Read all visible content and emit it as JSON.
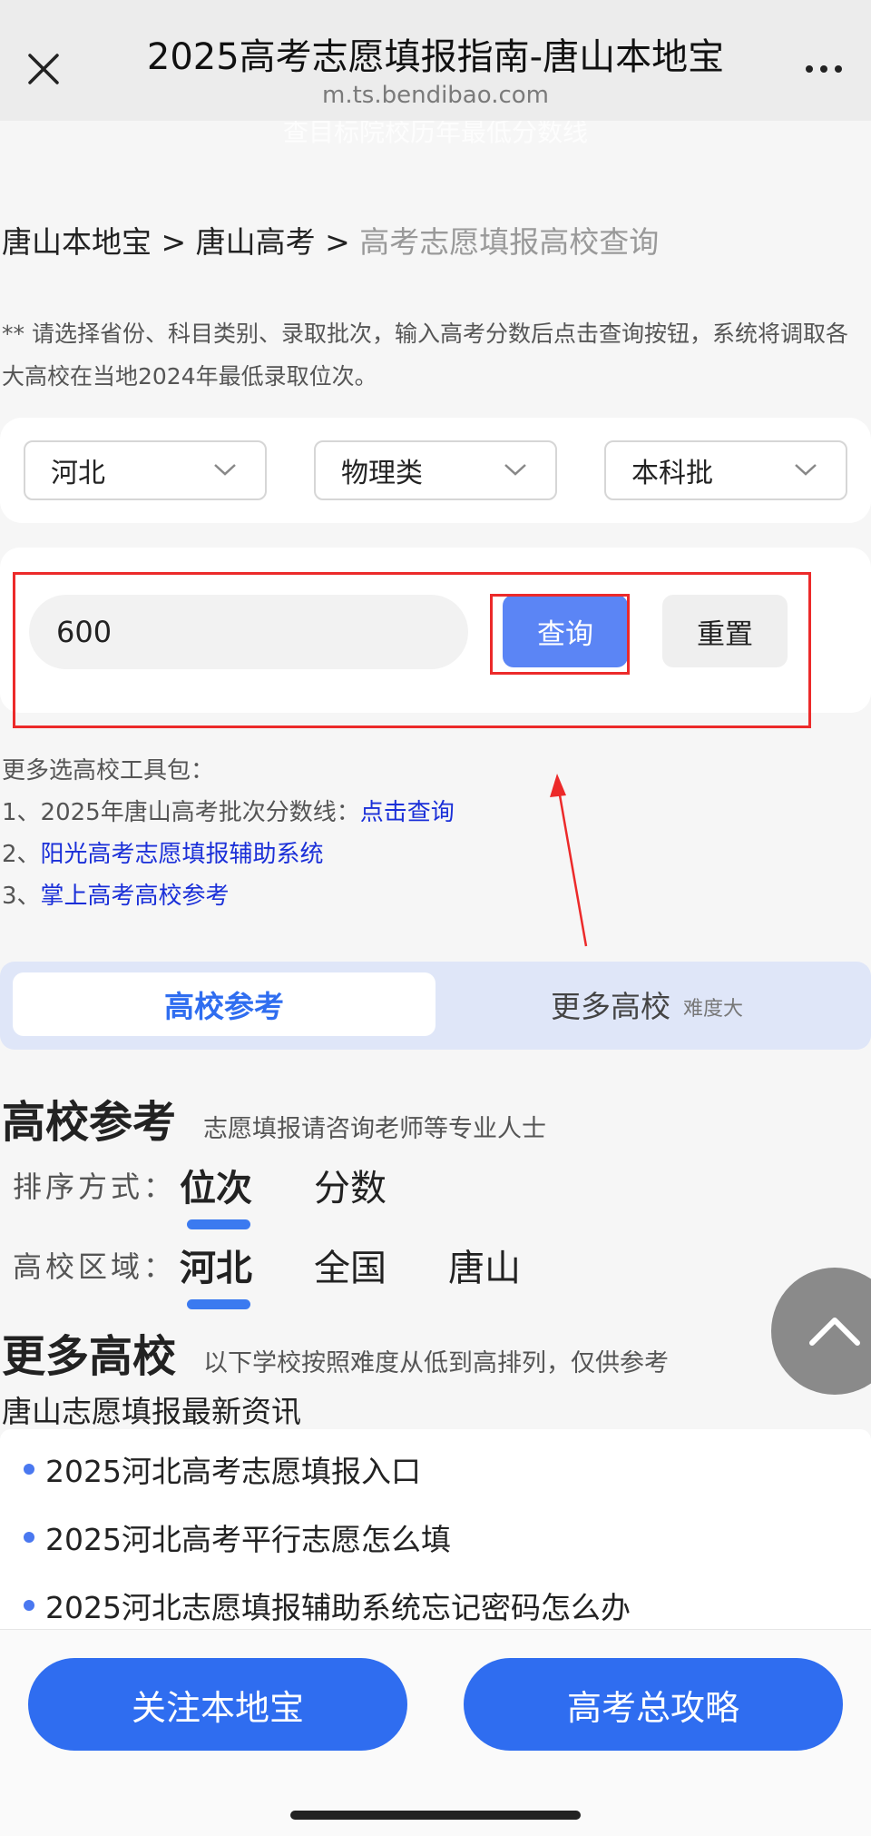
{
  "window": {
    "title": "2025高考志愿填报指南-唐山本地宝",
    "url": "m.ts.bendibao.com"
  },
  "ghost_text": "查目标院校历年最低分数线",
  "breadcrumb": {
    "home": "唐山本地宝",
    "sep": ">",
    "section": "唐山高考",
    "current": "高考志愿填报高校查询"
  },
  "instruction": "** 请选择省份、科目类别、录取批次，输入高考分数后点击查询按钮，系统将调取各大高校在当地2024年最低录取位次。",
  "filters": {
    "province": "河北",
    "subject": "物理类",
    "batch": "本科批"
  },
  "search": {
    "score_value": "600",
    "query_label": "查询",
    "reset_label": "重置"
  },
  "tools": {
    "heading": "更多选高校工具包：",
    "item1_prefix": "1、2025年唐山高考批次分数线：",
    "item1_link": "点击查询",
    "item2_prefix": "2、",
    "item2_link": "阳光高考志愿填报辅助系统",
    "item3_prefix": "3、",
    "item3_link": "掌上高考高校参考"
  },
  "tabs": {
    "active": "高校参考",
    "inactive": "更多高校",
    "inactive_sub": "难度大"
  },
  "reference": {
    "title": "高校参考",
    "subtitle": "志愿填报请咨询老师等专业人士",
    "sort_label": "排序方式：",
    "sort_options": [
      "位次",
      "分数"
    ],
    "region_label": "高校区域：",
    "region_options": [
      "河北",
      "全国",
      "唐山"
    ]
  },
  "more": {
    "title": "更多高校",
    "subtitle": "以下学校按照难度从低到高排列，仅供参考"
  },
  "news": {
    "title": "唐山志愿填报最新资讯",
    "items": [
      "2025河北高考志愿填报入口",
      "2025河北高考平行志愿怎么填",
      "2025河北志愿填报辅助系统忘记密码怎么办"
    ]
  },
  "bottom": {
    "follow_label": "关注本地宝",
    "guide_label": "高考总攻略"
  },
  "colors": {
    "accent": "#2f6df0",
    "query_button": "#5b85f5",
    "annotation_red": "#ec2a2a",
    "link": "#1a2fd8"
  },
  "icons": [
    "close-icon",
    "more-dots-icon",
    "chevron-down-icon",
    "arrow-up-icon"
  ]
}
